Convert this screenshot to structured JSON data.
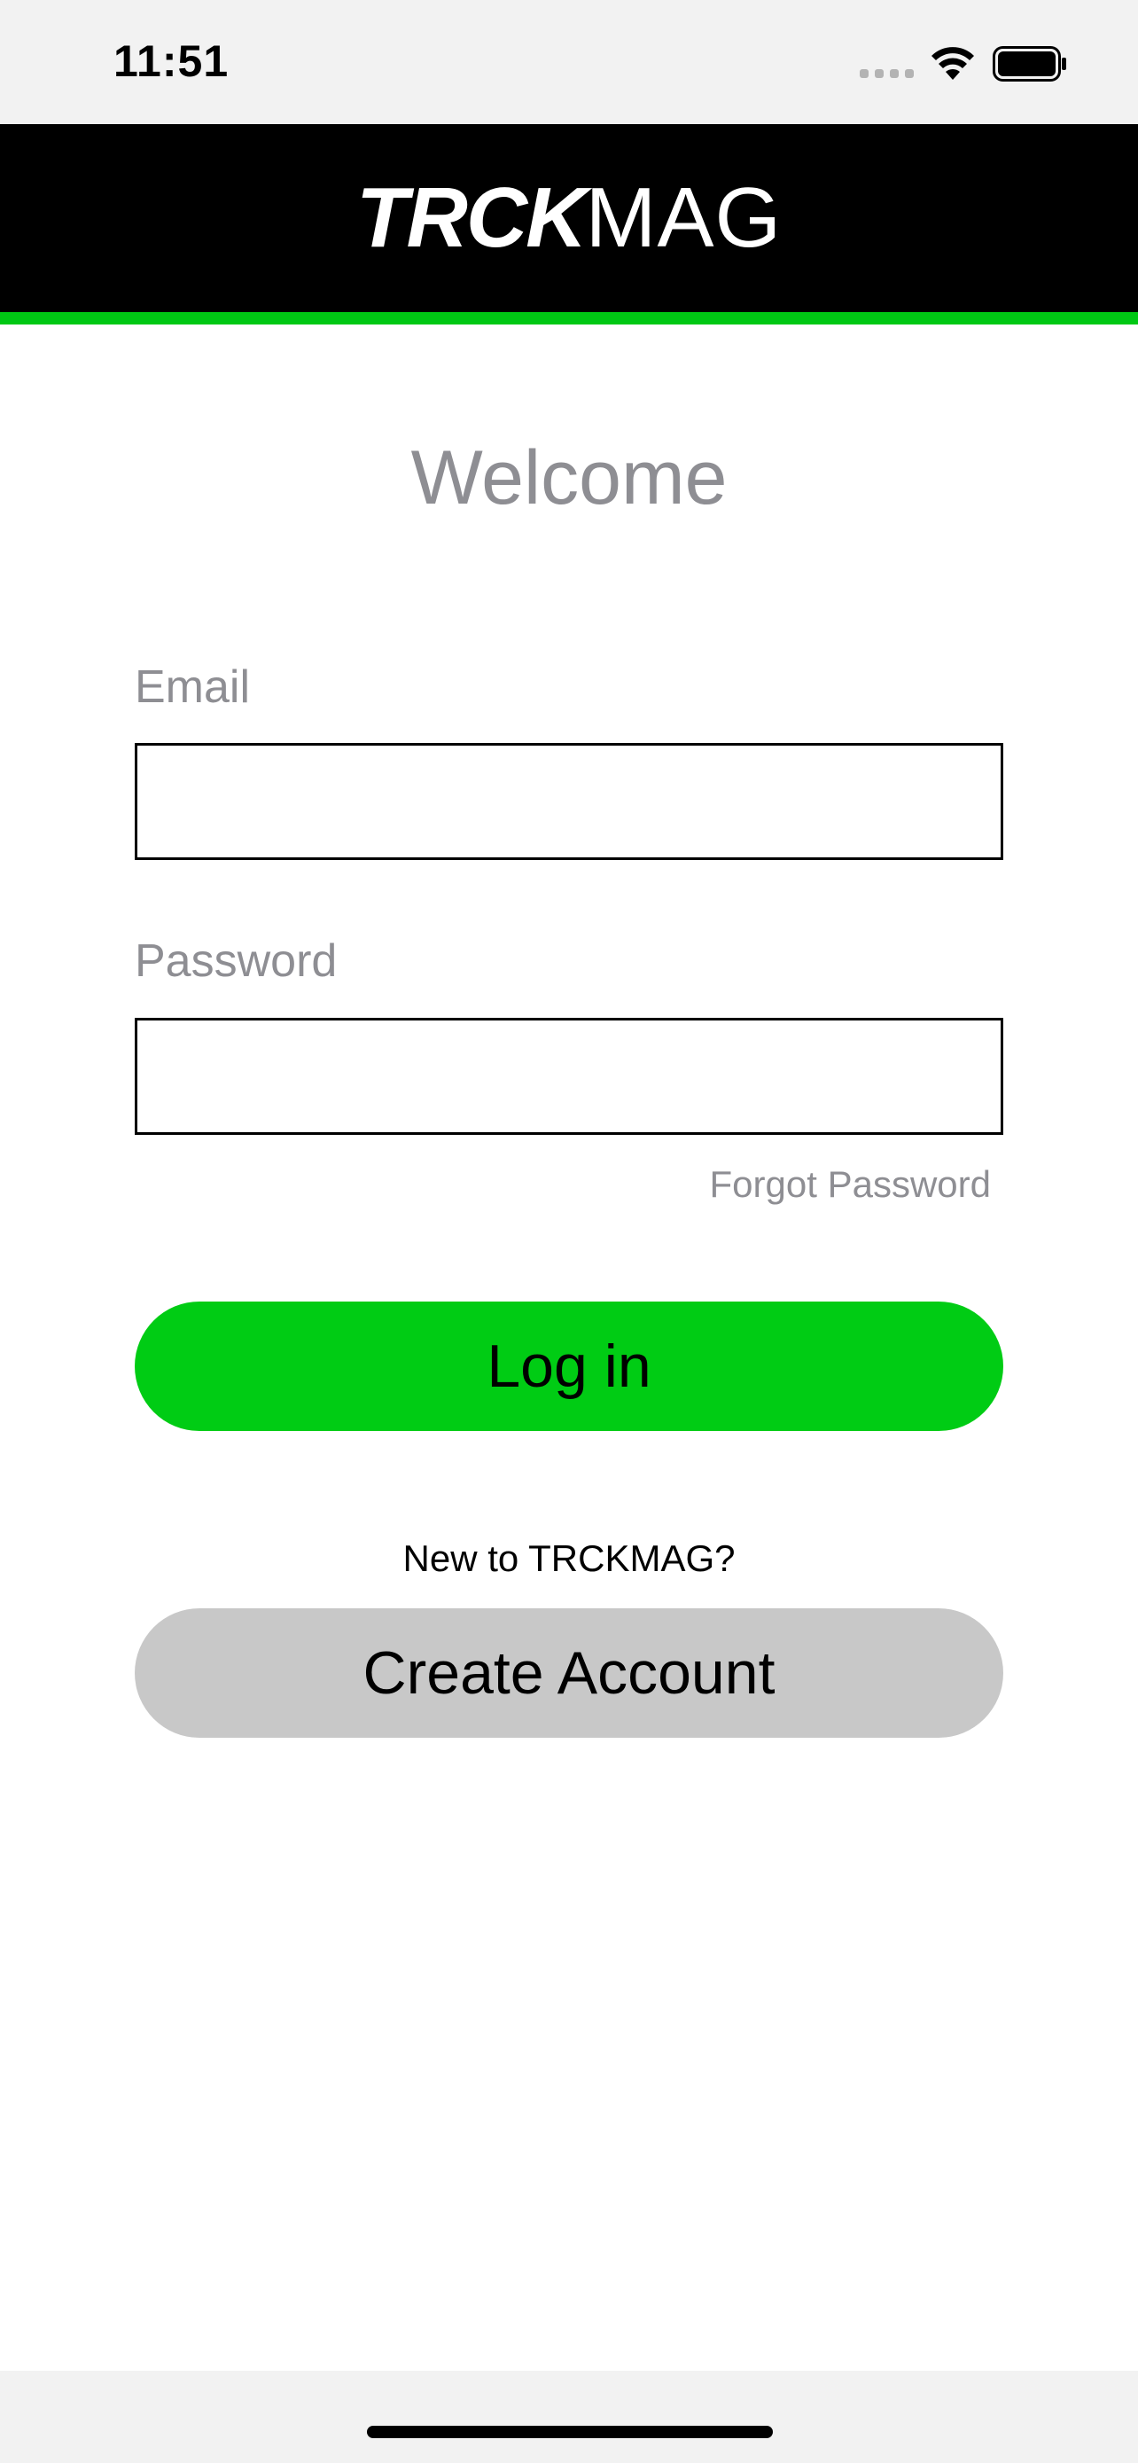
{
  "status_bar": {
    "time": "11:51",
    "icons": [
      "signal-icon",
      "wifi-icon",
      "battery-icon"
    ]
  },
  "header": {
    "logo_bold": "TRCK",
    "logo_light": "MAG",
    "background_color": "#000000",
    "accent_color": "#00c814"
  },
  "title": "Welcome",
  "form": {
    "email_label": "Email",
    "email_value": "",
    "password_label": "Password",
    "password_value": "",
    "forgot_password": "Forgot Password"
  },
  "login_button": {
    "label": "Log in",
    "color": "#00cc14"
  },
  "signup": {
    "prompt": "New to TRCKMAG?",
    "button_label": "Create Account",
    "button_color": "#c8c8c8"
  }
}
